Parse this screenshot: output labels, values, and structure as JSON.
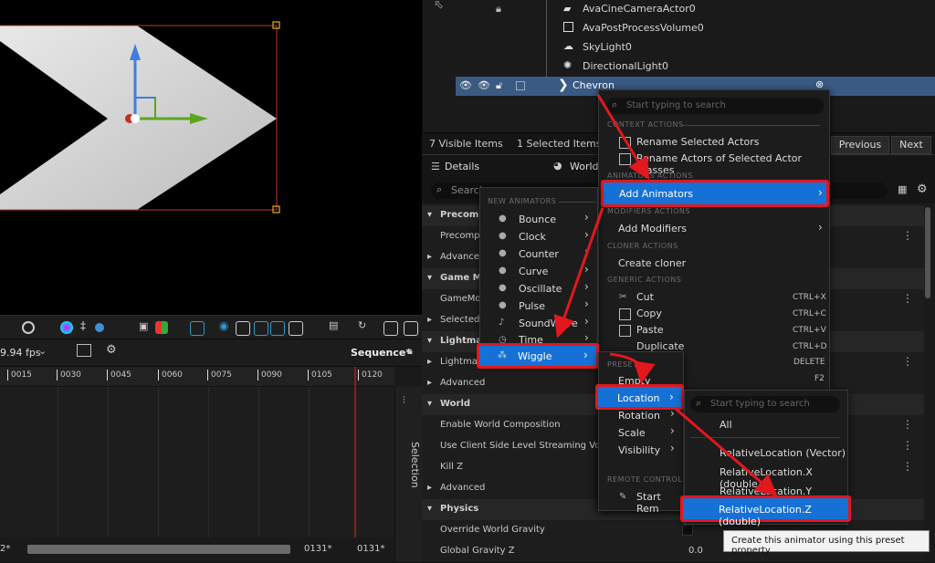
{
  "outliner": {
    "items": [
      {
        "label": "AvaCineCameraActor0"
      },
      {
        "label": "AvaPostProcessVolume0"
      },
      {
        "label": "SkyLight0"
      },
      {
        "label": "DirectionalLight0"
      },
      {
        "label": "Chevron"
      }
    ],
    "status_visible": "7 Visible Items",
    "status_selected": "1 Selected Items",
    "previous_label": "Previous",
    "next_label": "Next"
  },
  "details": {
    "tab_details": "Details",
    "tab_world": "World",
    "search_placeholder": "Search",
    "rows": [
      {
        "kind": "cat",
        "label": "Precompu"
      },
      {
        "kind": "prop",
        "label": "Precompu"
      },
      {
        "kind": "sub",
        "label": "Advanced"
      },
      {
        "kind": "cat",
        "label": "Game Mo"
      },
      {
        "kind": "prop",
        "label": "GameMod"
      },
      {
        "kind": "sub",
        "label": "Selected G"
      },
      {
        "kind": "cat",
        "label": "Lightmas"
      },
      {
        "kind": "sub",
        "label": "Lightmas"
      },
      {
        "kind": "sub",
        "label": "Advanced"
      },
      {
        "kind": "cat",
        "label": "World"
      },
      {
        "kind": "prop",
        "label": "Enable World Composition"
      },
      {
        "kind": "prop",
        "label": "Use Client Side Level Streaming Volume"
      },
      {
        "kind": "prop",
        "label": "Kill Z"
      },
      {
        "kind": "sub",
        "label": "Advanced"
      },
      {
        "kind": "cat",
        "label": "Physics"
      },
      {
        "kind": "prop",
        "label": "Override World Gravity"
      },
      {
        "kind": "prop",
        "label": "Global Gravity Z"
      }
    ],
    "gravity_value": "0.0",
    "tooltip": "Create this animator using this preset property"
  },
  "sequencer": {
    "fps": "9.94 fps",
    "name": "Sequence*",
    "ticks": [
      "0015",
      "0030",
      "0045",
      "0060",
      "0075",
      "0090",
      "0105",
      "0120"
    ],
    "selection_tab": "Selection",
    "bottom_left": "2*",
    "bottom_mid": "0131*",
    "bottom_right": "0131*"
  },
  "context_menu": {
    "search_placeholder": "Start typing to search",
    "headers": {
      "context": "CONTEXT ACTIONS",
      "animators": "ANIMATORS ACTIONS",
      "modifiers": "MODIFIERS ACTIONS",
      "cloner": "CLONER ACTIONS",
      "generic": "GENERIC ACTIONS"
    },
    "rename_selected": "Rename Selected Actors",
    "rename_classes": "Rename Actors of Selected Actor Classes",
    "add_animators": "Add Animators",
    "add_modifiers": "Add Modifiers",
    "create_cloner": "Create cloner",
    "cut": "Cut",
    "cut_sc": "CTRL+X",
    "copy": "Copy",
    "copy_sc": "CTRL+C",
    "paste": "Paste",
    "paste_sc": "CTRL+V",
    "duplicate": "Duplicate",
    "duplicate_sc": "CTRL+D",
    "delete_sc": "DELETE",
    "f2_sc": "F2"
  },
  "animators_menu": {
    "header": "NEW ANIMATORS",
    "items": [
      "Bounce",
      "Clock",
      "Counter",
      "Curve",
      "Oscillate",
      "Pulse",
      "SoundWave",
      "Time",
      "Wiggle"
    ]
  },
  "preset_menu": {
    "header": "PRESET",
    "items": [
      "Empty",
      "Location",
      "Rotation",
      "Scale",
      "Visibility"
    ],
    "remote_header": "REMOTE CONTROL",
    "start_remote": "Start Rem"
  },
  "location_menu": {
    "search_placeholder": "Start typing to search",
    "items": [
      "All",
      "RelativeLocation (Vector)",
      "RelativeLocation.X (double)",
      "RelativeLocation.Y (double)",
      "RelativeLocation.Z (double)"
    ]
  },
  "colors": {
    "highlight": "#1671d6",
    "annotation": "#e3171e",
    "selected_row": "#3b5a83"
  }
}
